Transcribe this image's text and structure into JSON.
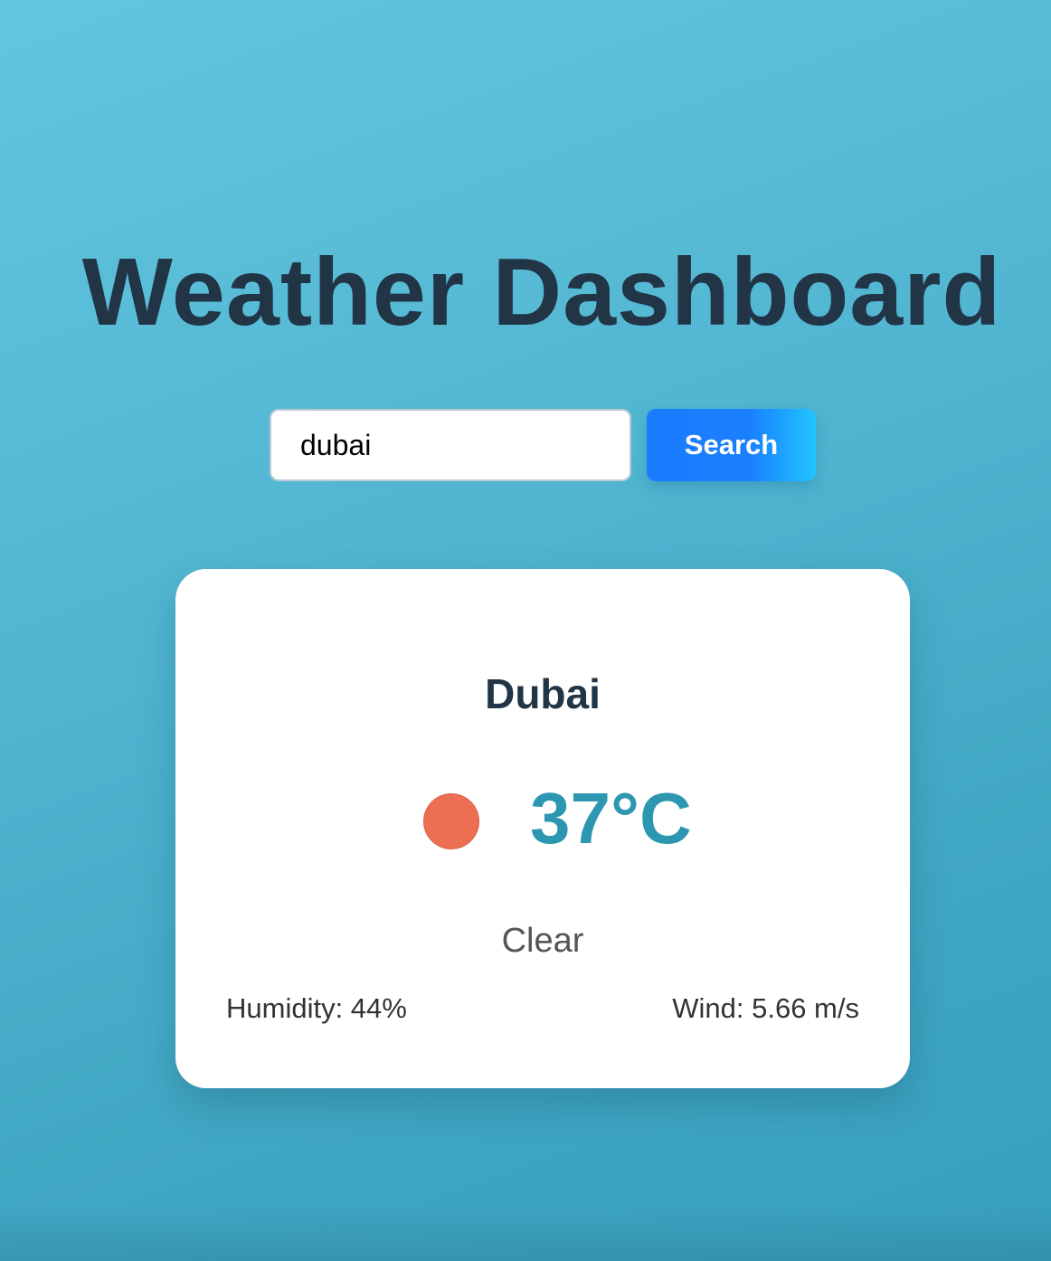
{
  "header": {
    "title": "Weather Dashboard"
  },
  "search": {
    "value": "dubai",
    "button_label": "Search"
  },
  "weather_card": {
    "city": "Dubai",
    "temperature": "37°C",
    "condition": "Clear",
    "humidity": "Humidity: 44%",
    "wind": "Wind: 5.66 m/s",
    "icon": "sun-icon"
  },
  "colors": {
    "title": "#213547",
    "button_start": "#1a7cff",
    "button_end": "#20c4ff",
    "temperature": "#2d97b2",
    "sun": "#ec6f53"
  }
}
